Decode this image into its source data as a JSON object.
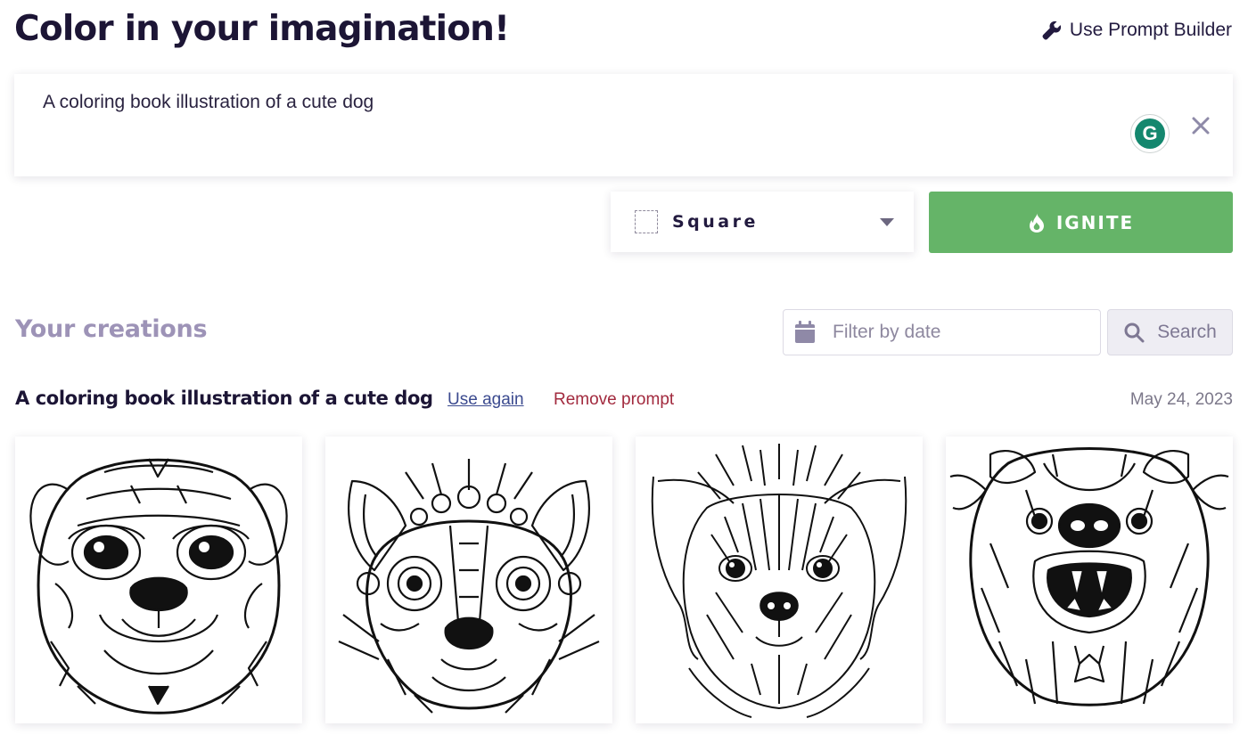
{
  "header": {
    "title": "Color in your imagination!",
    "prompt_builder_label": "Use Prompt Builder",
    "prompt_builder_icon": "wrench-icon"
  },
  "prompt_box": {
    "value": "A coloring book illustration of a cute dog",
    "grammarly_letter": "G",
    "clear_icon": "close-icon"
  },
  "aspect_select": {
    "selected": "Square",
    "icon": "square-dashed-icon"
  },
  "ignite_button": {
    "label": "IGNITE",
    "icon": "flame-icon",
    "color": "#65b468"
  },
  "creations": {
    "heading": "Your creations",
    "filter_placeholder": "Filter by date",
    "search_label": "Search",
    "groups": [
      {
        "prompt": "A coloring book illustration of a cute dog",
        "use_again_label": "Use again",
        "remove_label": "Remove prompt",
        "date": "May 24, 2023",
        "images": [
          {
            "subject": "pug-mandala-face"
          },
          {
            "subject": "raccoon-ornate-face"
          },
          {
            "subject": "shaggy-terrier-face"
          },
          {
            "subject": "bear-dog-growling-face"
          }
        ]
      }
    ]
  },
  "colors": {
    "heading": "#1c1535",
    "muted_heading": "#9d93b7",
    "link": "#3b4a8f",
    "danger": "#a22a3e",
    "accent_green": "#65b468"
  }
}
